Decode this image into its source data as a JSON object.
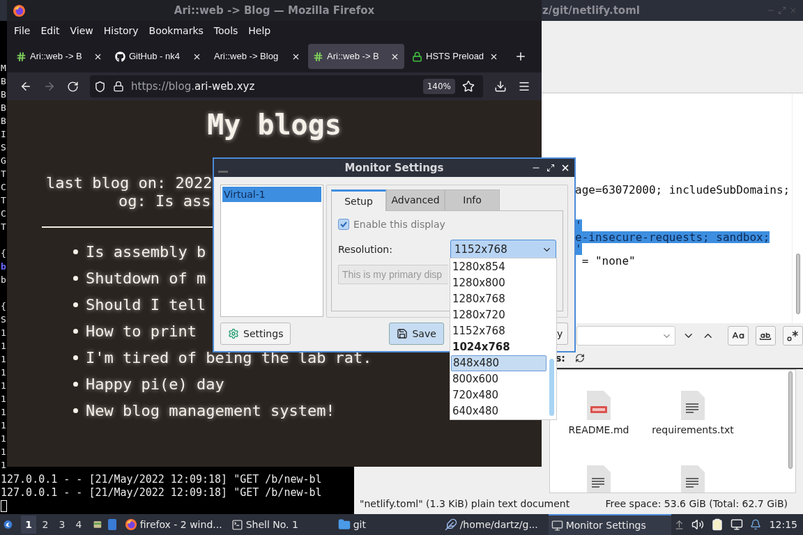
{
  "terminal": {
    "column_groups": [
      [
        {
          "text": "M",
          "highlight": false
        },
        {
          "text": "B",
          "highlight": false
        },
        {
          "text": "B",
          "highlight": false
        },
        {
          "text": "B",
          "highlight": false
        },
        {
          "text": "B",
          "highlight": false
        },
        {
          "text": "I",
          "highlight": false
        },
        {
          "text": "S",
          "highlight": false
        },
        {
          "text": "G",
          "highlight": false
        },
        {
          "text": "T",
          "highlight": false
        },
        {
          "text": "C",
          "highlight": false
        },
        {
          "text": "T",
          "highlight": false
        },
        {
          "text": "C",
          "highlight": false
        },
        {
          "text": "T",
          "highlight": false
        }
      ],
      [
        {
          "text": "{",
          "highlight": false
        },
        {
          "text": "b",
          "highlight": true
        },
        {
          "text": "b",
          "highlight": false
        }
      ],
      [
        {
          "text": "{",
          "highlight": false
        },
        {
          "text": "S",
          "highlight": false
        },
        {
          "text": "1",
          "highlight": false
        },
        {
          "text": "1",
          "highlight": false
        },
        {
          "text": "1",
          "highlight": false
        },
        {
          "text": "1",
          "highlight": false
        },
        {
          "text": "1",
          "highlight": false
        },
        {
          "text": "1",
          "highlight": false
        },
        {
          "text": "1",
          "highlight": false
        },
        {
          "text": "1",
          "highlight": false
        },
        {
          "text": "1",
          "highlight": false
        },
        {
          "text": "1",
          "highlight": false
        },
        {
          "text": "1",
          "highlight": false
        }
      ]
    ],
    "log_lines": [
      "127.0.0.1 - - [21/May/2022 12:09:18] \"GET /b/new-bl",
      "127.0.0.1 - - [21/May/2022 12:09:18] \"GET /b/new-bl"
    ]
  },
  "firefox": {
    "title": "Ari::web -> Blog — Mozilla Firefox",
    "menu": [
      "File",
      "Edit",
      "View",
      "History",
      "Bookmarks",
      "Tools",
      "Help"
    ],
    "tabs": [
      {
        "title": "Ari::web -> B",
        "kind": "hash",
        "selected": false
      },
      {
        "title": "GitHub - nk4",
        "kind": "github",
        "selected": false
      },
      {
        "title": "Ari::web -> Blog",
        "kind": "none",
        "selected": false
      },
      {
        "title": "Ari::web -> B",
        "kind": "hash",
        "selected": true
      },
      {
        "title": "HSTS Preload",
        "kind": "lock",
        "selected": false
      }
    ],
    "forward_disabled": true,
    "url_dim": "https://blog.",
    "url_main": "ari-web.xyz",
    "zoom": "140%",
    "page": {
      "heading": "My blogs",
      "last_blog": "last blog on: 2022",
      "last_blog_title": "og: Is ass",
      "posts": [
        "Is assembly b",
        "Shutdown of m",
        "Should I tell",
        "How to print",
        "I'm tired of being the lab rat.",
        "Happy pi(e) day",
        "New blog management system!"
      ]
    }
  },
  "editor": {
    "title": "z/git/netlify.toml",
    "lines": [
      {
        "kind": "code",
        "text": "age=63072000; includeSubDomains;",
        "selected": false
      },
      {
        "kind": "blank"
      },
      {
        "kind": "blank"
      },
      {
        "kind": "code",
        "text": "'",
        "selected": true
      },
      {
        "kind": "code",
        "text": "e-insecure-requests; sandbox;",
        "selected": true
      },
      {
        "kind": "code",
        "text": "'",
        "selected": true
      },
      {
        "kind": "code",
        "text": " = \"none\"",
        "selected": false
      }
    ]
  },
  "file_manager": {
    "filter_label": "s:",
    "files": [
      {
        "name": "README.md",
        "kind": "markdown"
      },
      {
        "name": "requirements.txt",
        "kind": "text"
      },
      {
        "kind": "text"
      },
      {
        "kind": "text"
      }
    ],
    "status_left": "\"netlify.toml\" (1.3 KiB) plain text document",
    "status_right": "Free space: 53.6 GiB (Total: 62.7 GiB)"
  },
  "dialog": {
    "title": "Monitor Settings",
    "outputs": [
      {
        "name": "Virtual-1",
        "selected": true
      }
    ],
    "tabs": [
      {
        "label": "Setup",
        "selected": true
      },
      {
        "label": "Advanced",
        "selected": false
      },
      {
        "label": "Info",
        "selected": false
      }
    ],
    "enable": {
      "label": "Enable this display",
      "checked": true
    },
    "resolution_label": "Resolution:",
    "resolution_value": "1152x768",
    "primary_button": "This is my primary disp",
    "buttons": [
      {
        "label": "Settings",
        "kind": "settings"
      },
      {
        "label": "Save",
        "kind": "save"
      },
      {
        "label": "y",
        "kind": "plain"
      }
    ],
    "resolution_options": [
      {
        "label": "1280x854",
        "selected": false,
        "current": false
      },
      {
        "label": "1280x800",
        "selected": false,
        "current": false
      },
      {
        "label": "1280x768",
        "selected": false,
        "current": false
      },
      {
        "label": "1280x720",
        "selected": false,
        "current": false
      },
      {
        "label": "1152x768",
        "selected": false,
        "current": false
      },
      {
        "label": "1024x768",
        "selected": false,
        "current": true
      },
      {
        "label": "848x480",
        "selected": true,
        "current": false
      },
      {
        "label": "800x600",
        "selected": false,
        "current": false
      },
      {
        "label": "720x480",
        "selected": false,
        "current": false
      },
      {
        "label": "640x480",
        "selected": false,
        "current": false
      }
    ]
  },
  "taskbar": {
    "workspaces": [
      {
        "label": "1",
        "selected": true
      },
      {
        "label": "2",
        "selected": false
      },
      {
        "label": "3",
        "selected": false
      },
      {
        "label": "4",
        "selected": false
      }
    ],
    "tasks": [
      {
        "label": "firefox - 2 wind...",
        "kind": "firefox",
        "selected": false
      },
      {
        "label": "Shell No. 1",
        "kind": "terminal",
        "selected": false
      },
      {
        "label": "git",
        "kind": "folder",
        "selected": false
      },
      {
        "label": "/home/dartz/g...",
        "kind": "editor",
        "selected": false
      },
      {
        "label": "Monitor Settings",
        "kind": "monitor",
        "selected": true
      }
    ],
    "clock": "12:15"
  }
}
